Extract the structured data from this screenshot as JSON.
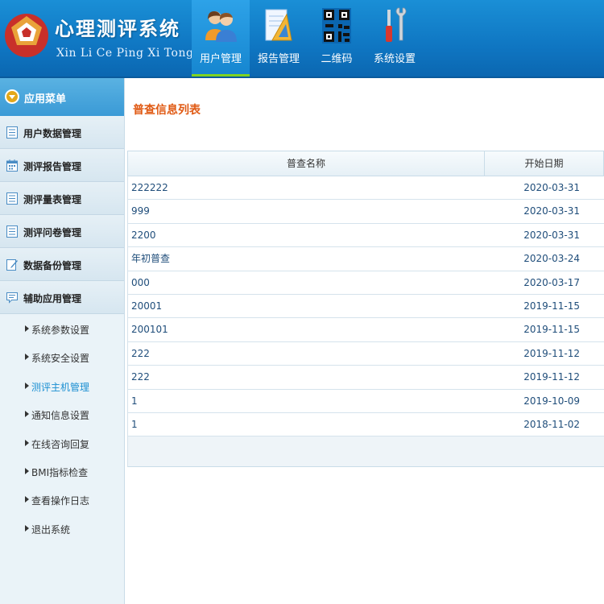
{
  "header": {
    "brand_cn": "心理测评系统",
    "brand_en": "Xin Li Ce Ping Xi Tong",
    "nav": [
      {
        "label": "用户管理",
        "icon": "users-icon",
        "active": true
      },
      {
        "label": "报告管理",
        "icon": "report-icon",
        "active": false
      },
      {
        "label": "二维码",
        "icon": "qrcode-icon",
        "active": false
      },
      {
        "label": "系统设置",
        "icon": "tools-icon",
        "active": false
      }
    ]
  },
  "sidebar": {
    "title": "应用菜单",
    "items": [
      {
        "label": "用户数据管理",
        "icon": "list-icon"
      },
      {
        "label": "测评报告管理",
        "icon": "calendar-icon"
      },
      {
        "label": "测评量表管理",
        "icon": "list-icon"
      },
      {
        "label": "测评问卷管理",
        "icon": "list-icon"
      },
      {
        "label": "数据备份管理",
        "icon": "edit-icon"
      },
      {
        "label": "辅助应用管理",
        "icon": "chat-icon"
      }
    ],
    "sub_items": [
      {
        "label": "系统参数设置",
        "active": false
      },
      {
        "label": "系统安全设置",
        "active": false
      },
      {
        "label": "测评主机管理",
        "active": true
      },
      {
        "label": "通知信息设置",
        "active": false
      },
      {
        "label": "在线咨询回复",
        "active": false
      },
      {
        "label": "BMI指标检查",
        "active": false
      },
      {
        "label": "查看操作日志",
        "active": false
      },
      {
        "label": "退出系统",
        "active": false
      }
    ]
  },
  "main": {
    "title": "普查信息列表",
    "columns": [
      "普查名称",
      "开始日期"
    ],
    "rows": [
      {
        "name": "222222",
        "date": "2020-03-31"
      },
      {
        "name": "999",
        "date": "2020-03-31"
      },
      {
        "name": "2200",
        "date": "2020-03-31"
      },
      {
        "name": "年初普查",
        "date": "2020-03-24"
      },
      {
        "name": "000",
        "date": "2020-03-17"
      },
      {
        "name": "20001",
        "date": "2019-11-15"
      },
      {
        "name": "200101",
        "date": "2019-11-15"
      },
      {
        "name": "222",
        "date": "2019-11-12"
      },
      {
        "name": "222",
        "date": "2019-11-12"
      },
      {
        "name": "1",
        "date": "2019-10-09"
      },
      {
        "name": "1",
        "date": "2018-11-02"
      }
    ]
  },
  "colors": {
    "header_blue": "#0f76c2",
    "active_green": "#7ed321",
    "title_orange": "#e05a14",
    "link_blue": "#1b8fd2"
  }
}
